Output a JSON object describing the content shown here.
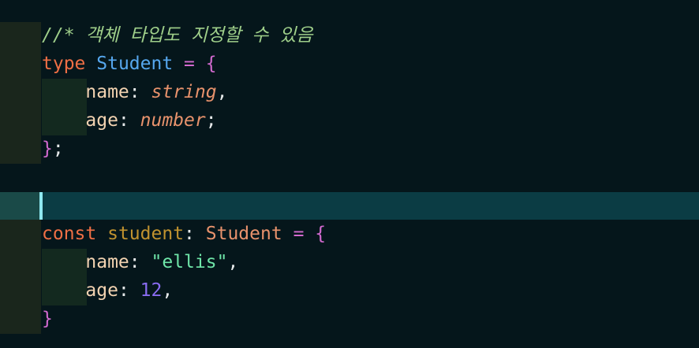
{
  "editor": {
    "language": "typescript",
    "cursor_line": 7,
    "lines": [
      {
        "tokens": [
          {
            "text": "//* 객체 타입도 지정할 수 있음",
            "kind": "comment"
          }
        ]
      },
      {
        "tokens": [
          {
            "text": "type",
            "kind": "keyword"
          },
          {
            "text": " ",
            "kind": "space"
          },
          {
            "text": "Student",
            "kind": "type-name"
          },
          {
            "text": " ",
            "kind": "space"
          },
          {
            "text": "=",
            "kind": "operator"
          },
          {
            "text": " ",
            "kind": "space"
          },
          {
            "text": "{",
            "kind": "brace"
          }
        ]
      },
      {
        "indent": "    ",
        "tokens": [
          {
            "text": "name",
            "kind": "property"
          },
          {
            "text": ":",
            "kind": "punctuation"
          },
          {
            "text": " ",
            "kind": "space"
          },
          {
            "text": "string",
            "kind": "type-keyword"
          },
          {
            "text": ",",
            "kind": "punctuation"
          }
        ]
      },
      {
        "indent": "    ",
        "tokens": [
          {
            "text": "age",
            "kind": "property"
          },
          {
            "text": ":",
            "kind": "punctuation"
          },
          {
            "text": " ",
            "kind": "space"
          },
          {
            "text": "number",
            "kind": "type-keyword"
          },
          {
            "text": ";",
            "kind": "punctuation"
          }
        ]
      },
      {
        "tokens": [
          {
            "text": "}",
            "kind": "brace"
          },
          {
            "text": ";",
            "kind": "punctuation"
          }
        ]
      },
      {
        "tokens": []
      },
      {
        "tokens": []
      },
      {
        "tokens": [
          {
            "text": "const",
            "kind": "keyword"
          },
          {
            "text": " ",
            "kind": "space"
          },
          {
            "text": "student",
            "kind": "variable"
          },
          {
            "text": ":",
            "kind": "punctuation"
          },
          {
            "text": " ",
            "kind": "space"
          },
          {
            "text": "Student",
            "kind": "type-ref"
          },
          {
            "text": " ",
            "kind": "space"
          },
          {
            "text": "=",
            "kind": "operator"
          },
          {
            "text": " ",
            "kind": "space"
          },
          {
            "text": "{",
            "kind": "brace"
          }
        ]
      },
      {
        "indent": "    ",
        "tokens": [
          {
            "text": "name",
            "kind": "property"
          },
          {
            "text": ":",
            "kind": "punctuation"
          },
          {
            "text": " ",
            "kind": "space"
          },
          {
            "text": "\"ellis\"",
            "kind": "string"
          },
          {
            "text": ",",
            "kind": "punctuation"
          }
        ]
      },
      {
        "indent": "    ",
        "tokens": [
          {
            "text": "age",
            "kind": "property"
          },
          {
            "text": ":",
            "kind": "punctuation"
          },
          {
            "text": " ",
            "kind": "space"
          },
          {
            "text": "12",
            "kind": "number"
          },
          {
            "text": ",",
            "kind": "punctuation"
          }
        ]
      },
      {
        "tokens": [
          {
            "text": "}",
            "kind": "brace"
          }
        ]
      }
    ]
  },
  "colors": {
    "background": "#05161b",
    "current_line": "#0b3c44",
    "cursor": "#8fe8f0",
    "comment": "#9fcf8a",
    "keyword": "#ef6f45",
    "type_name": "#56a7ee",
    "string": "#6fe6a9",
    "number": "#8a6cf2",
    "brace": "#d36ad0"
  }
}
